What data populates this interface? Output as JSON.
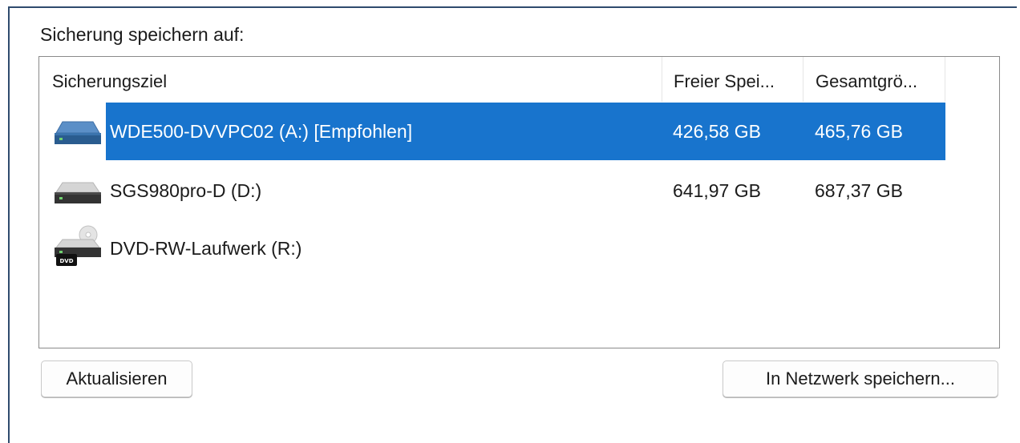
{
  "section_label": "Sicherung speichern auf:",
  "columns": {
    "target": "Sicherungsziel",
    "free": "Freier Spei...",
    "total": "Gesamtgrö..."
  },
  "drives": [
    {
      "name": "WDE500-DVVPC02 (A:) [Empfohlen]",
      "free": "426,58 GB",
      "total": "465,76 GB",
      "icon": "hard-drive-icon",
      "selected": true
    },
    {
      "name": "SGS980pro-D (D:)",
      "free": "641,97 GB",
      "total": "687,37 GB",
      "icon": "hard-drive-icon",
      "selected": false
    },
    {
      "name": "DVD-RW-Laufwerk (R:)",
      "free": "",
      "total": "",
      "icon": "dvd-drive-icon",
      "icon_label": "DVD",
      "selected": false
    }
  ],
  "buttons": {
    "refresh": "Aktualisieren",
    "network": "In Netzwerk speichern..."
  },
  "colors": {
    "selection": "#1874cd",
    "frame_border": "#2f4b6e"
  }
}
